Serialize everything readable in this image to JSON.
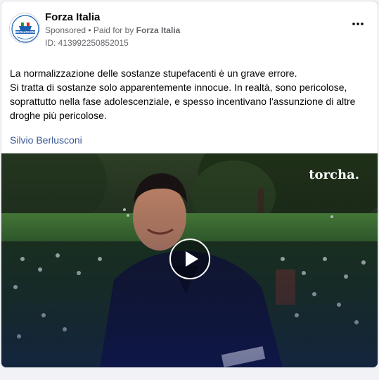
{
  "header": {
    "page_name": "Forza Italia",
    "sponsored": "Sponsored",
    "paid_for_prefix": "• Paid for by",
    "paid_for_by": "Forza Italia",
    "ad_id": "ID: 413992250852015",
    "more_icon": "more-horizontal-icon"
  },
  "avatar": {
    "logo_text": "BERLUSCONI"
  },
  "post": {
    "line1": "La normalizzazione delle sostanze stupefacenti è un grave errore.",
    "line2": "Si tratta di sostanze solo apparentemente innocue. In realtà, sono pericolose, soprattutto nella fase adolescenziale, e spesso incentivano l'assunzione di altre droghe più pericolose.",
    "signature": "Silvio Berlusconi"
  },
  "video": {
    "watermark": "torcha.",
    "play_icon": "play-icon"
  },
  "colors": {
    "link": "#385898",
    "text": "#050505",
    "muted": "#65676b"
  }
}
